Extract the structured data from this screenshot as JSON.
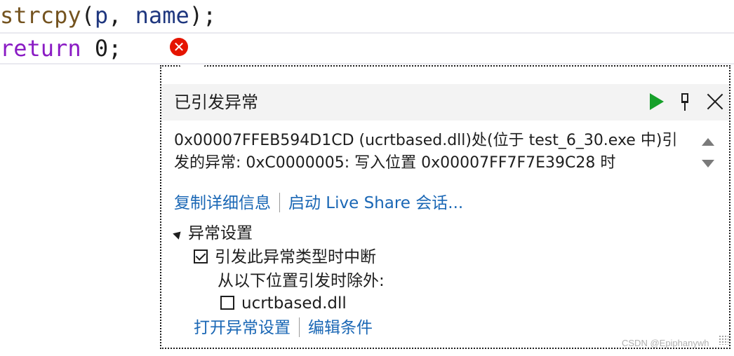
{
  "editor": {
    "line1": {
      "fn": "strcpy",
      "open": "(",
      "arg1": "p",
      "comma": ", ",
      "arg2": "name",
      "close": ");"
    },
    "line2": {
      "kw": "return",
      "space": " ",
      "num": "0",
      "semi": ";"
    },
    "error_icon": "✕"
  },
  "popup": {
    "title": "已引发异常",
    "message": "0x00007FFEB594D1CD (ucrtbased.dll)处(位于 test_6_30.exe 中)引发的异常: 0xC0000005: 写入位置 0x00007FF7F7E39C28 时",
    "links": {
      "copy_details": "复制详细信息",
      "live_share": "启动 Live Share 会话..."
    },
    "settings": {
      "header": "异常设置",
      "break_on_type": "引发此异常类型时中断",
      "except_from": "从以下位置引发时除外:",
      "module": "ucrtbased.dll"
    },
    "bottom_links": {
      "open_settings": "打开异常设置",
      "edit_conditions": "编辑条件"
    }
  },
  "watermark": "CSDN @Epiphanywh",
  "colors": {
    "keyword": "#8a1bc4",
    "identifier": "#1f377f",
    "function": "#74531f",
    "number": "#1e1e1e",
    "link": "#1a67b5",
    "error": "#e51400",
    "run": "#16a02a"
  }
}
